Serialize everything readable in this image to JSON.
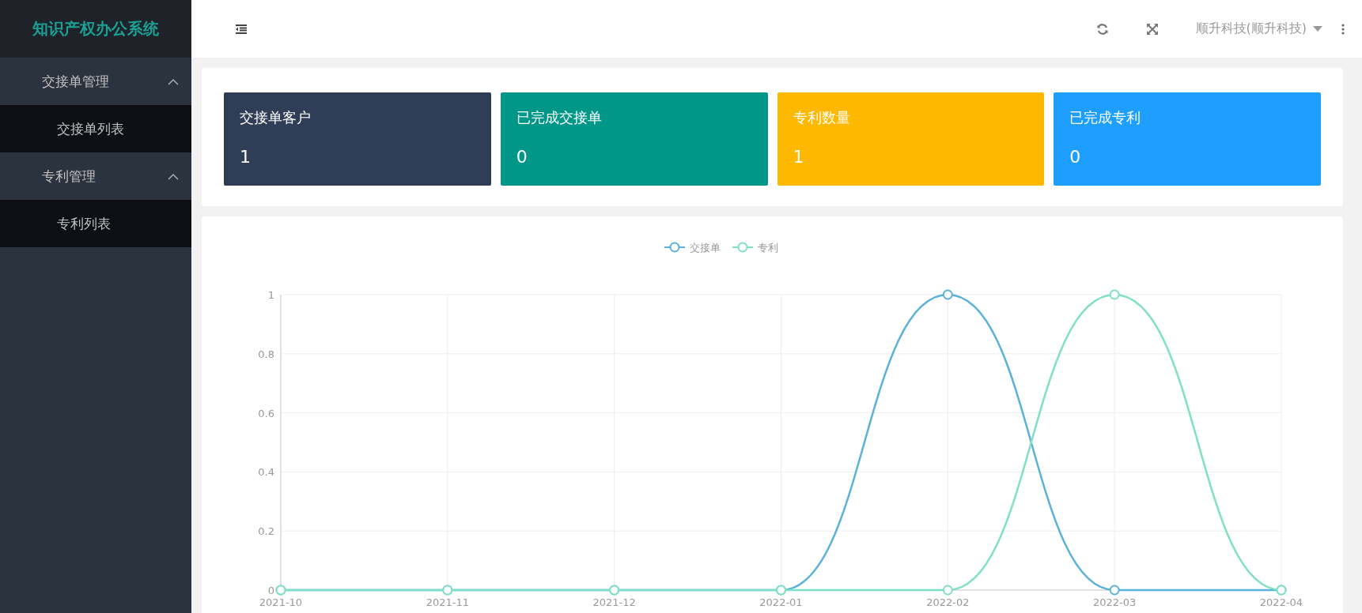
{
  "sidebar": {
    "title": "知识产权办公系统",
    "groups": [
      {
        "label": "交接单管理",
        "expanded": true,
        "items": [
          {
            "label": "交接单列表",
            "selected": false
          }
        ]
      },
      {
        "label": "专利管理",
        "expanded": true,
        "items": [
          {
            "label": "专利列表",
            "selected": false
          }
        ]
      }
    ]
  },
  "header": {
    "user": "顺升科技(顺升科技)"
  },
  "stats": [
    {
      "title": "交接单客户",
      "value": "1",
      "color": "#2f3e56"
    },
    {
      "title": "已完成交接单",
      "value": "0",
      "color": "#009688"
    },
    {
      "title": "专利数量",
      "value": "1",
      "color": "#ffb800"
    },
    {
      "title": "已完成专利",
      "value": "0",
      "color": "#1e9fff"
    }
  ],
  "chart": {
    "chart_data": {
      "type": "line",
      "grid": true,
      "legend": true,
      "categories": [
        "2021-10",
        "2021-11",
        "2021-12",
        "2022-01",
        "2022-02",
        "2022-03",
        "2022-04"
      ],
      "ylim": [
        0,
        1
      ],
      "yticks": [
        {
          "value": 0,
          "label": "0"
        },
        {
          "value": 0.2,
          "label": "0.2"
        },
        {
          "value": 0.4,
          "label": "0.4"
        },
        {
          "value": 0.6,
          "label": "0.6"
        },
        {
          "value": 0.8,
          "label": "0.8"
        },
        {
          "value": 1,
          "label": "1"
        }
      ],
      "series": [
        {
          "name": "交接单",
          "color": "#5ab1d9",
          "marker": "circle",
          "values": [
            0,
            0,
            0,
            0,
            1,
            0,
            0
          ]
        },
        {
          "name": "专利",
          "color": "#7fe0c5",
          "marker": "circle",
          "values": [
            0,
            0,
            0,
            0,
            0,
            1,
            0
          ]
        }
      ]
    }
  }
}
